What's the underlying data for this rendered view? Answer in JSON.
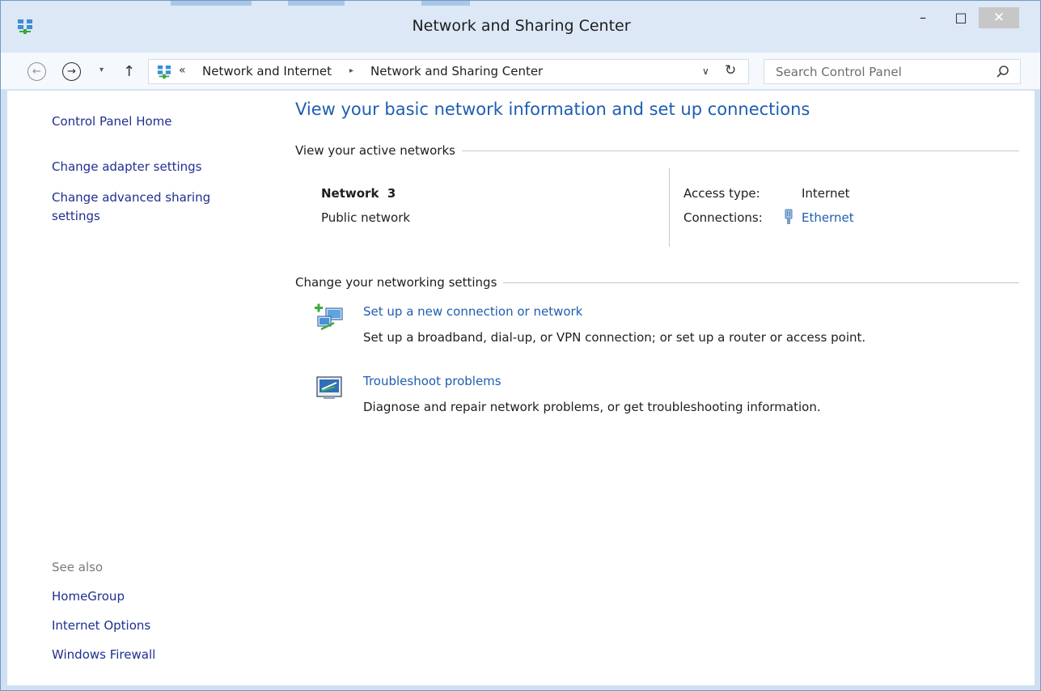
{
  "window": {
    "title": "Network and Sharing Center",
    "controls": {
      "minimize": "–",
      "maximize": "□",
      "close": "✕"
    }
  },
  "navigation": {
    "back_glyph": "←",
    "forward_glyph": "→",
    "recent_glyph": "▾",
    "up_glyph": "↑",
    "address": {
      "overflow_glyph": "«",
      "breadcrumbs": [
        "Network and Internet",
        "Network and Sharing Center"
      ],
      "separator_glyph": "▸",
      "dropdown_glyph": "∨",
      "refresh_glyph": "↻"
    },
    "search": {
      "placeholder": "Search Control Panel"
    }
  },
  "sidebar": {
    "links": [
      "Control Panel Home",
      "Change adapter settings",
      "Change advanced sharing settings"
    ],
    "see_also_label": "See also",
    "see_also_links": [
      "HomeGroup",
      "Internet Options",
      "Windows Firewall"
    ]
  },
  "main": {
    "heading": "View your basic network information and set up connections",
    "active_networks": {
      "section_label": "View your active networks",
      "network_name": "Network  3",
      "network_type": "Public network",
      "access_type_label": "Access type:",
      "access_type_value": "Internet",
      "connections_label": "Connections:",
      "connection_link": "Ethernet"
    },
    "change_settings": {
      "section_label": "Change your networking settings",
      "tasks": [
        {
          "link": "Set up a new connection or network",
          "description": "Set up a broadband, dial-up, or VPN connection; or set up a router or access point."
        },
        {
          "link": "Troubleshoot problems",
          "description": "Diagnose and repair network problems, or get troubleshooting information."
        }
      ]
    }
  },
  "colors": {
    "link_blue": "#1e5eb0",
    "nav_link": "#1f2f8f",
    "frame": "#cfe0f3",
    "content_bg": "#ffffff"
  },
  "icons": {
    "title": "network-center-icon",
    "address": "network-center-icon",
    "search": "magnifier-icon",
    "ethernet": "ethernet-plug-icon",
    "new_connection": "new-connection-icon",
    "troubleshoot": "troubleshoot-icon"
  }
}
